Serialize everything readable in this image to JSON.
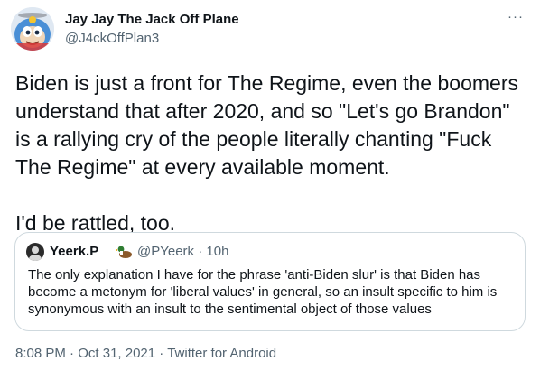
{
  "author": {
    "name": "Jay Jay The Jack Off Plane",
    "handle": "@J4ckOffPlan3",
    "avatar_icon": "cartoon-airplane-avatar"
  },
  "more_icon": "ellipsis-icon",
  "more_label": "···",
  "tweet_text": "Biden is just a front for The Regime, even the boomers\nunderstand that after 2020, and so \"Let's go Brandon\"\nis a rallying cry of the people literally chanting \"Fuck\nThe Regime\" at every available moment.\n\nI'd be rattled, too.",
  "quoted_tweet": {
    "name": "Yeerk.P",
    "emoji_icon": "duck-emoji-icon",
    "handle": "@PYeerk",
    "separator": "·",
    "time_ago": "10h",
    "text": "The only explanation I have for the phrase 'anti-Biden slur' is that Biden has become a metonym for 'liberal values' in general, so an insult specific to him is synonymous with an insult to the sentimental object of those values"
  },
  "metadata": {
    "time": "8:08 PM",
    "separator": "·",
    "date": "Oct 31, 2021",
    "source": "Twitter for Android"
  },
  "colors": {
    "text": "#0f1419",
    "secondary": "#536471",
    "border": "#cfd9de",
    "avatar_blue": "#4a8fd6",
    "avatar_yellow": "#f4c430"
  }
}
